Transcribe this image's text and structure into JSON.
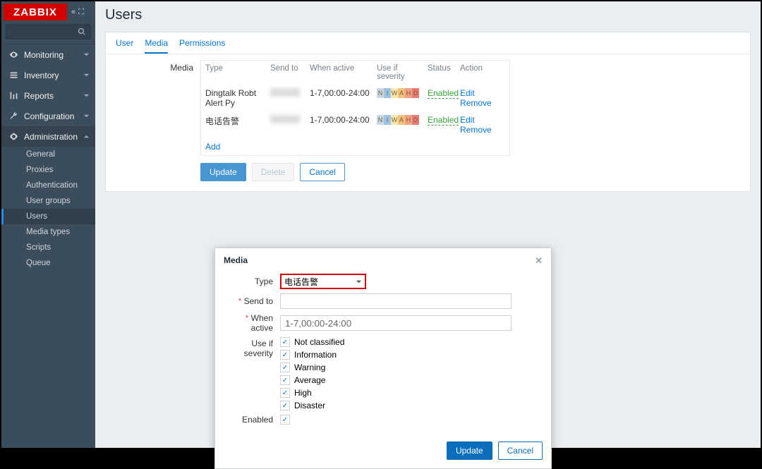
{
  "brand": "ZABBIX",
  "sidebar": {
    "items": [
      {
        "label": "Monitoring"
      },
      {
        "label": "Inventory"
      },
      {
        "label": "Reports"
      },
      {
        "label": "Configuration"
      },
      {
        "label": "Administration"
      }
    ],
    "admin_sub": [
      {
        "label": "General"
      },
      {
        "label": "Proxies"
      },
      {
        "label": "Authentication"
      },
      {
        "label": "User groups"
      },
      {
        "label": "Users"
      },
      {
        "label": "Media types"
      },
      {
        "label": "Scripts"
      },
      {
        "label": "Queue"
      }
    ]
  },
  "page": {
    "title": "Users",
    "tabs": [
      "User",
      "Media",
      "Permissions"
    ],
    "form_label": "Media",
    "table": {
      "headers": {
        "type": "Type",
        "send": "Send to",
        "when": "When active",
        "sev": "Use if severity",
        "status": "Status",
        "action": "Action"
      },
      "rows": [
        {
          "type": "Dingtalk Robt Alert Py",
          "when": "1-7,00:00-24:00",
          "status": "Enabled",
          "edit": "Edit",
          "remove": "Remove"
        },
        {
          "type": "电话告警",
          "when": "1-7,00:00-24:00",
          "status": "Enabled",
          "edit": "Edit",
          "remove": "Remove"
        }
      ],
      "add": "Add"
    },
    "buttons": {
      "update": "Update",
      "delete": "Delete",
      "cancel": "Cancel"
    }
  },
  "modal": {
    "title": "Media",
    "labels": {
      "type": "Type",
      "send_to": "Send to",
      "when_active": "When active",
      "use_if_severity": "Use if severity",
      "enabled": "Enabled"
    },
    "type_value": "电话告警",
    "send_to_value": "",
    "when_active_value": "1-7,00:00-24:00",
    "severities": [
      "Not classified",
      "Information",
      "Warning",
      "Average",
      "High",
      "Disaster"
    ],
    "buttons": {
      "update": "Update",
      "cancel": "Cancel"
    }
  }
}
